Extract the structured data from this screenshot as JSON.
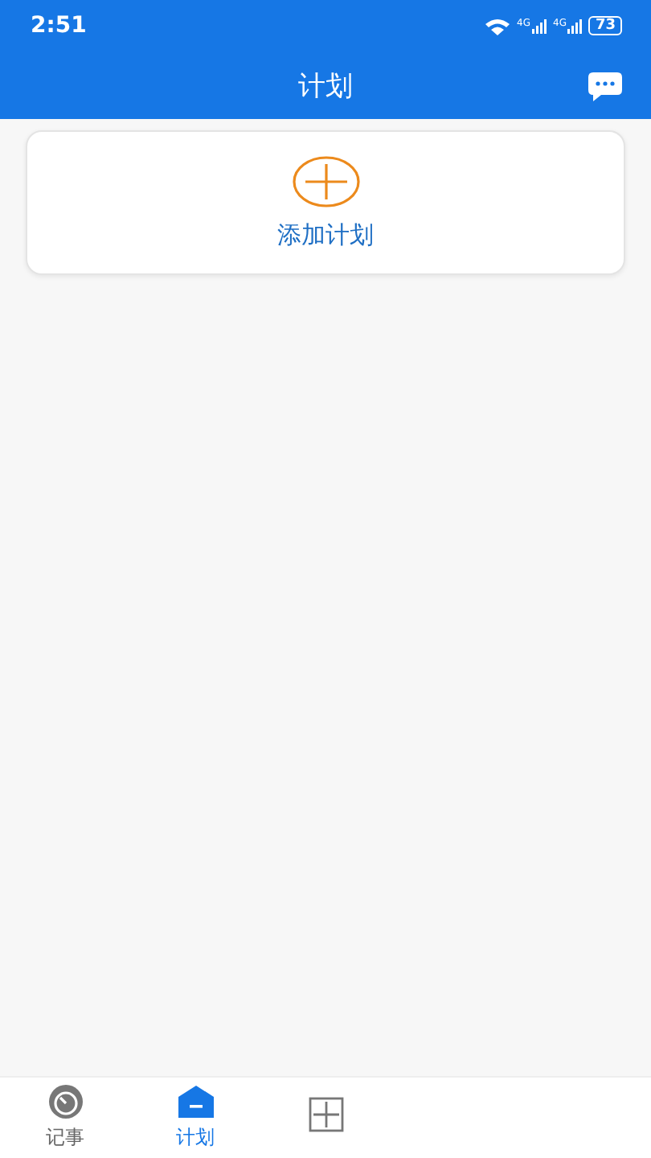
{
  "status_bar": {
    "time": "2:51",
    "networks": [
      "4G",
      "4G"
    ],
    "battery": "73"
  },
  "header": {
    "title": "计划"
  },
  "add_card": {
    "label": "添加计划"
  },
  "tabs": [
    {
      "label": "记事",
      "selected": false
    },
    {
      "label": "计划",
      "selected": true
    },
    {
      "selected": false
    }
  ]
}
